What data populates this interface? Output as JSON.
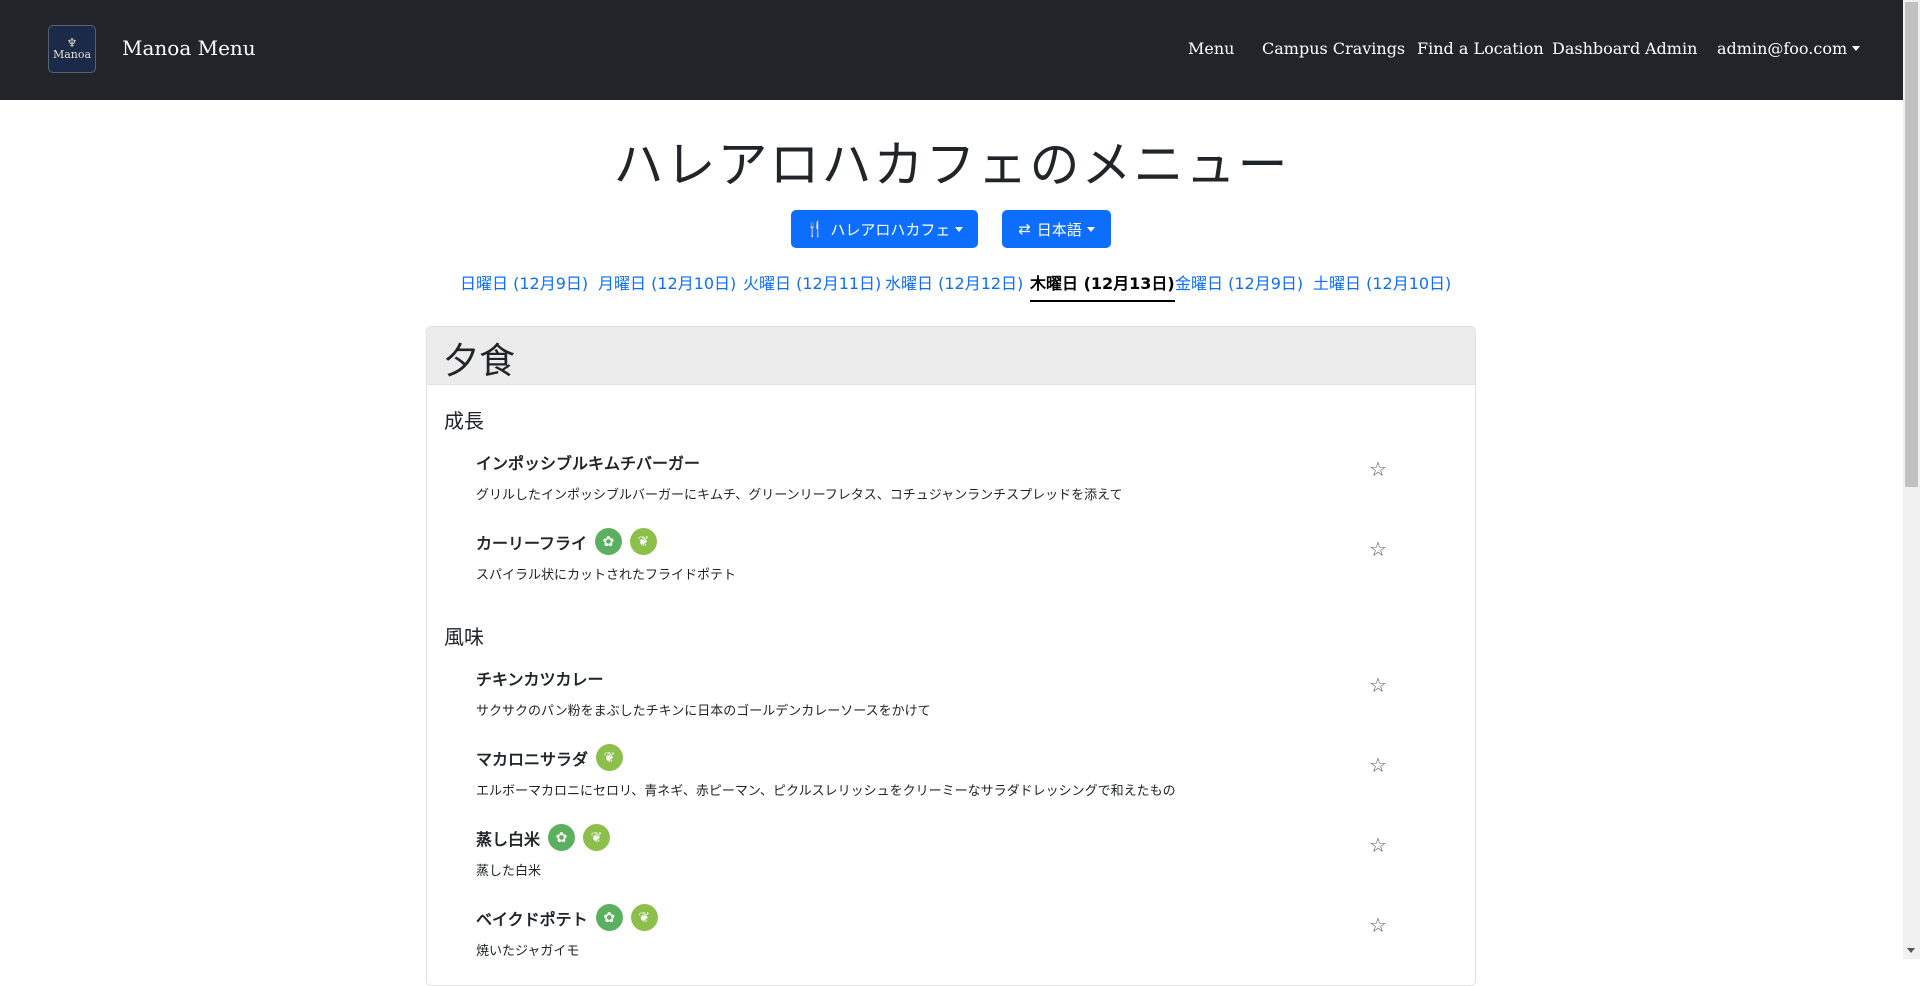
{
  "navbar": {
    "logo_glyph": "♆",
    "logo_text": "Manoa",
    "brand": "Manoa Menu",
    "links": {
      "menu": "Menu",
      "campus_cravings": "Campus Cravings",
      "find_location": "Find a Location",
      "dashboard": "Dashboard",
      "admin": "Admin",
      "user": "admin@foo.com"
    }
  },
  "page": {
    "title": "ハレアロハカフェのメニュー",
    "location_button": "ハレアロハカフェ",
    "language_button": "日本語",
    "location_icon": "🍴",
    "language_icon": "⇄"
  },
  "days": [
    "日曜日 (12月9日)",
    "月曜日 (12月10日)",
    "火曜日 (12月11日)",
    "水曜日 (12月12日)",
    "木曜日 (12月13日)",
    "金曜日 (12月9日)",
    "土曜日 (12月10日)"
  ],
  "active_day_index": 4,
  "meal": {
    "title": "夕食",
    "stations": [
      {
        "name": "成長",
        "items": [
          {
            "name": "インポッシブルキムチバーガー",
            "desc": "グリルしたインポッシブルバーガーにキムチ、グリーンリーフレタス、コチュジャンランチスプレッドを添えて",
            "badges": []
          },
          {
            "name": "カーリーフライ",
            "desc": "スパイラル状にカットされたフライドポテト",
            "badges": [
              "vegan",
              "vegetarian"
            ]
          }
        ]
      },
      {
        "name": "風味",
        "items": [
          {
            "name": "チキンカツカレー",
            "desc": "サクサクのパン粉をまぶしたチキンに日本のゴールデンカレーソースをかけて",
            "badges": []
          },
          {
            "name": "マカロニサラダ",
            "desc": "エルボーマカロニにセロリ、青ネギ、赤ピーマン、ピクルスレリッシュをクリーミーなサラダドレッシングで和えたもの",
            "badges": [
              "vegetarian"
            ]
          },
          {
            "name": "蒸し白米",
            "desc": "蒸した白米",
            "badges": [
              "vegan",
              "vegetarian"
            ]
          },
          {
            "name": "ベイクドポテト",
            "desc": "焼いたジャガイモ",
            "badges": [
              "vegan",
              "vegetarian"
            ]
          }
        ]
      }
    ]
  },
  "icons": {
    "star": "☆",
    "vegan_leaf": "✿",
    "veg_leaf": "❦"
  },
  "colors": {
    "navbar": "#212529",
    "primary": "#0d6efd",
    "vegan_badge": "#5bb05f",
    "vegetarian_badge": "#8cc04a"
  }
}
